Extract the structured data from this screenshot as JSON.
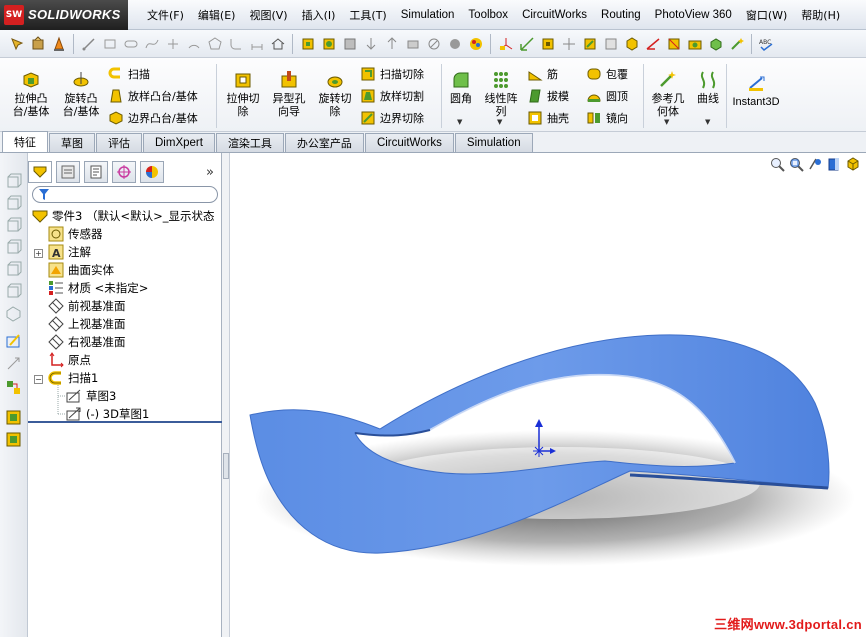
{
  "app": {
    "logo_badge": "SW",
    "logo_text": "SOLIDWORKS"
  },
  "menu": [
    {
      "label": "文件(F)",
      "latin": false
    },
    {
      "label": "编辑(E)",
      "latin": false
    },
    {
      "label": "视图(V)",
      "latin": false
    },
    {
      "label": "插入(I)",
      "latin": false
    },
    {
      "label": "工具(T)",
      "latin": false
    },
    {
      "label": "Simulation",
      "latin": true
    },
    {
      "label": "Toolbox",
      "latin": true
    },
    {
      "label": "CircuitWorks",
      "latin": true
    },
    {
      "label": "Routing",
      "latin": true
    },
    {
      "label": "PhotoView 360",
      "latin": true
    },
    {
      "label": "窗口(W)",
      "latin": false
    },
    {
      "label": "帮助(H)",
      "latin": false
    }
  ],
  "commands": {
    "extrude_boss": "拉伸凸\n台/基体",
    "revolve_boss": "旋转凸\n台/基体",
    "sweep": "扫描",
    "loft_boss": "放样凸台/基体",
    "boundary_boss": "边界凸台/基体",
    "extrude_cut": "拉伸切\n除",
    "hole_wizard": "异型孔\n向导",
    "revolve_cut": "旋转切\n除",
    "swept_cut": "扫描切除",
    "lofted_cut": "放样切割",
    "boundary_cut": "边界切除",
    "fillet": "圆角",
    "linear_pattern": "线性阵\n列",
    "rib": "筋",
    "draft": "拔模",
    "shell": "抽壳",
    "wrap": "包覆",
    "dome": "圆顶",
    "mirror": "镜向",
    "ref_geometry": "参考几\n何体",
    "curves": "曲线",
    "instant3d": "Instant3D"
  },
  "tabs": [
    {
      "label": "特征",
      "active": true,
      "latin": false
    },
    {
      "label": "草图",
      "active": false,
      "latin": false
    },
    {
      "label": "评估",
      "active": false,
      "latin": false
    },
    {
      "label": "DimXpert",
      "active": false,
      "latin": true
    },
    {
      "label": "渲染工具",
      "active": false,
      "latin": false
    },
    {
      "label": "办公室产品",
      "active": false,
      "latin": false
    },
    {
      "label": "CircuitWorks",
      "active": false,
      "latin": true
    },
    {
      "label": "Simulation",
      "active": false,
      "latin": true
    }
  ],
  "feature_tree": {
    "more_symbol": "»",
    "root": "零件3  （默认<默认>_显示状态",
    "items": {
      "sensors": "传感器",
      "annotations": "注解",
      "surface_bodies": "曲面实体",
      "material": "材质 <未指定>",
      "front_plane": "前视基准面",
      "top_plane": "上视基准面",
      "right_plane": "右视基准面",
      "origin": "原点",
      "sweep1": "扫描1",
      "sketch3": "草图3",
      "sketch3d": "(-) 3D草图1"
    },
    "expand_plus": "+",
    "expand_minus": "−"
  },
  "watermark": "三维网www.3dportal.cn",
  "colors": {
    "model_blue": "#5b8de4",
    "model_edge": "#3f6fc8",
    "accent_yellow": "#f2c200",
    "watermark_red": "#e21a1a"
  }
}
